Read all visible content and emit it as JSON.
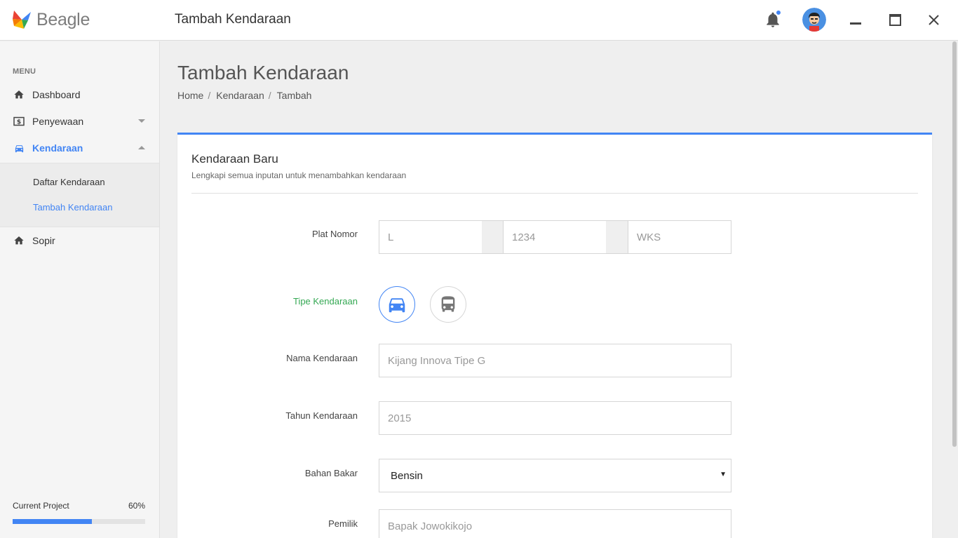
{
  "app": {
    "name": "Beagle",
    "window_title": "Tambah Kendaraan"
  },
  "colors": {
    "accent": "#4285f4",
    "success": "#34a853"
  },
  "sidebar": {
    "menu_header": "MENU",
    "items": [
      {
        "label": "Dashboard",
        "icon": "home-icon"
      },
      {
        "label": "Penyewaan",
        "icon": "dollar-icon"
      },
      {
        "label": "Kendaraan",
        "icon": "car-icon"
      },
      {
        "label": "Sopir",
        "icon": "home-icon"
      }
    ],
    "subitems": [
      {
        "label": "Daftar Kendaraan"
      },
      {
        "label": "Tambah Kendaraan"
      }
    ],
    "project": {
      "label": "Current Project",
      "value": "60%",
      "progress": 0.6
    }
  },
  "main": {
    "page_title": "Tambah Kendaraan",
    "breadcrumb": {
      "home": "Home",
      "section": "Kendaraan",
      "current": "Tambah"
    },
    "card": {
      "title": "Kendaraan Baru",
      "subtitle": "Lengkapi semua inputan untuk menambahkan kendaraan"
    },
    "form": {
      "plat_label": "Plat Nomor",
      "plat_1_placeholder": "L",
      "plat_2_placeholder": "1234",
      "plat_3_placeholder": "WKS",
      "tipe_label": "Tipe Kendaraan",
      "tipe_options": [
        "car-icon",
        "bus-icon"
      ],
      "nama_label": "Nama Kendaraan",
      "nama_placeholder": "Kijang Innova Tipe G",
      "tahun_label": "Tahun Kendaraan",
      "tahun_placeholder": "2015",
      "bahan_label": "Bahan Bakar",
      "bahan_value": "Bensin",
      "pemilik_label": "Pemilik",
      "pemilik_placeholder": "Bapak Jowokikojo"
    }
  }
}
